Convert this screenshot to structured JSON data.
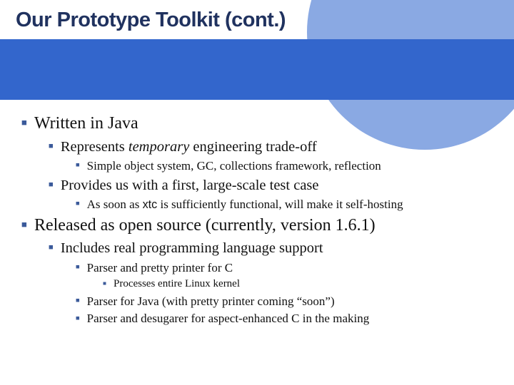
{
  "title": "Our Prototype Toolkit (cont.)",
  "bullets": {
    "b1": "Written in Java",
    "b1_1_pre": "Represents ",
    "b1_1_em": "temporary",
    "b1_1_post": " engineering trade-off",
    "b1_1_1": "Simple object system, GC, collections framework, reflection",
    "b1_2": "Provides us with a first, large-scale test case",
    "b1_2_1_pre": "As soon as ",
    "b1_2_1_code": "xtc",
    "b1_2_1_post": " is sufficiently functional, will make it self-hosting",
    "b2": "Released as open source (currently, version 1.6.1)",
    "b2_1": "Includes real programming language support",
    "b2_1_1": "Parser and pretty printer for C",
    "b2_1_1_1": "Processes entire Linux kernel",
    "b2_1_2": "Parser for Java (with pretty printer coming “soon”)",
    "b2_1_3": "Parser and desugarer for aspect-enhanced C in the making"
  }
}
